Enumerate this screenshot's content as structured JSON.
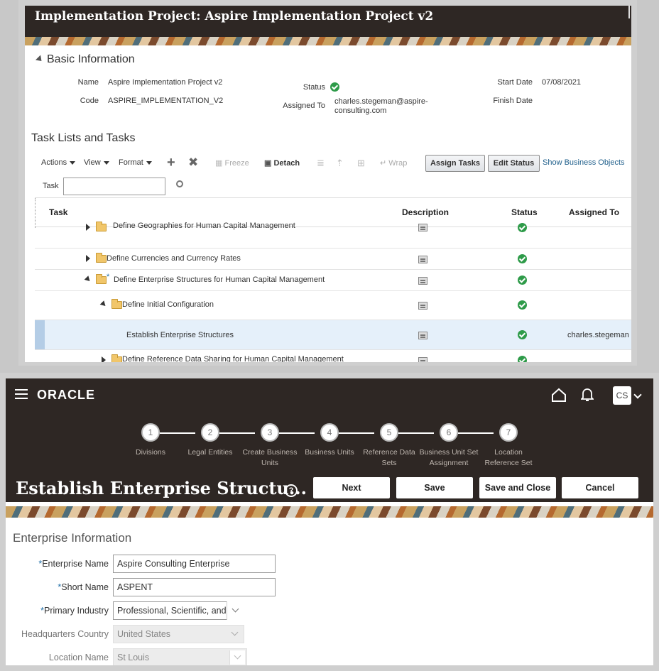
{
  "top": {
    "title": "Implementation Project: Aspire Implementation Project v2",
    "basic_info": {
      "section_title": "Basic Information",
      "name_label": "Name",
      "name_value": "Aspire Implementation Project v2",
      "code_label": "Code",
      "code_value": "ASPIRE_IMPLEMENTATION_V2",
      "status_label": "Status",
      "assigned_label": "Assigned To",
      "assigned_line1": "charles.stegeman@aspire-",
      "assigned_line2": "consulting.com",
      "start_label": "Start Date",
      "start_value": "07/08/2021",
      "finish_label": "Finish Date"
    },
    "tasks": {
      "section_title": "Task Lists and Tasks",
      "toolbar": {
        "actions": "Actions",
        "view": "View",
        "format": "Format",
        "freeze": "Freeze",
        "detach": "Detach",
        "wrap": "Wrap",
        "assign_tasks": "Assign Tasks",
        "edit_status": "Edit Status",
        "show_business_objects": "Show Business Objects"
      },
      "search_label": "Task",
      "search_value": "",
      "columns": [
        "Task",
        "Description",
        "Status",
        "Assigned To"
      ],
      "rows": [
        {
          "name": "Define Geographies for Human Capital Management",
          "assigned": ""
        },
        {
          "name": "Define Currencies and Currency Rates",
          "assigned": ""
        },
        {
          "name": "Define Enterprise Structures for Human Capital Management",
          "assigned": "",
          "required_mark": "*"
        },
        {
          "name": "Define Initial Configuration",
          "assigned": ""
        },
        {
          "name": "Establish Enterprise Structures",
          "assigned": "charles.stegeman"
        },
        {
          "name": "Define Reference Data Sharing for Human Capital Management",
          "assigned": ""
        }
      ]
    }
  },
  "bottom": {
    "logo": "ORACLE",
    "avatar": "CS",
    "train": [
      {
        "num": "1",
        "label": "Divisions"
      },
      {
        "num": "2",
        "label": "Legal Entities"
      },
      {
        "num": "3",
        "label": "Create Business Units"
      },
      {
        "num": "4",
        "label": "Business Units"
      },
      {
        "num": "5",
        "label": "Reference Data Sets"
      },
      {
        "num": "6",
        "label": "Business Unit Set Assignment"
      },
      {
        "num": "7",
        "label": "Location Reference Set"
      }
    ],
    "page_title": "Establish Enterprise Structu...",
    "help_glyph": "?",
    "buttons": {
      "next": "Next",
      "save": "Save",
      "save_close": "Save and Close",
      "cancel": "Cancel"
    },
    "form": {
      "title": "Enterprise Information",
      "required_mark": "*",
      "enterprise_name_label": "Enterprise Name",
      "enterprise_name_value": "Aspire Consulting Enterprise",
      "short_name_label": "Short Name",
      "short_name_value": "ASPENT",
      "primary_industry_label": "Primary Industry",
      "primary_industry_value": "Professional, Scientific, and",
      "hq_country_label": "Headquarters Country",
      "hq_country_value": "United States",
      "location_name_label": "Location Name",
      "location_name_value": "St Louis"
    }
  },
  "colors": {
    "header_bg": "#2e2724",
    "status_green": "#2e9b49",
    "link_blue": "#1f5f8b",
    "required_blue": "#1f6fa8",
    "selected_row": "#e5f0fa"
  }
}
